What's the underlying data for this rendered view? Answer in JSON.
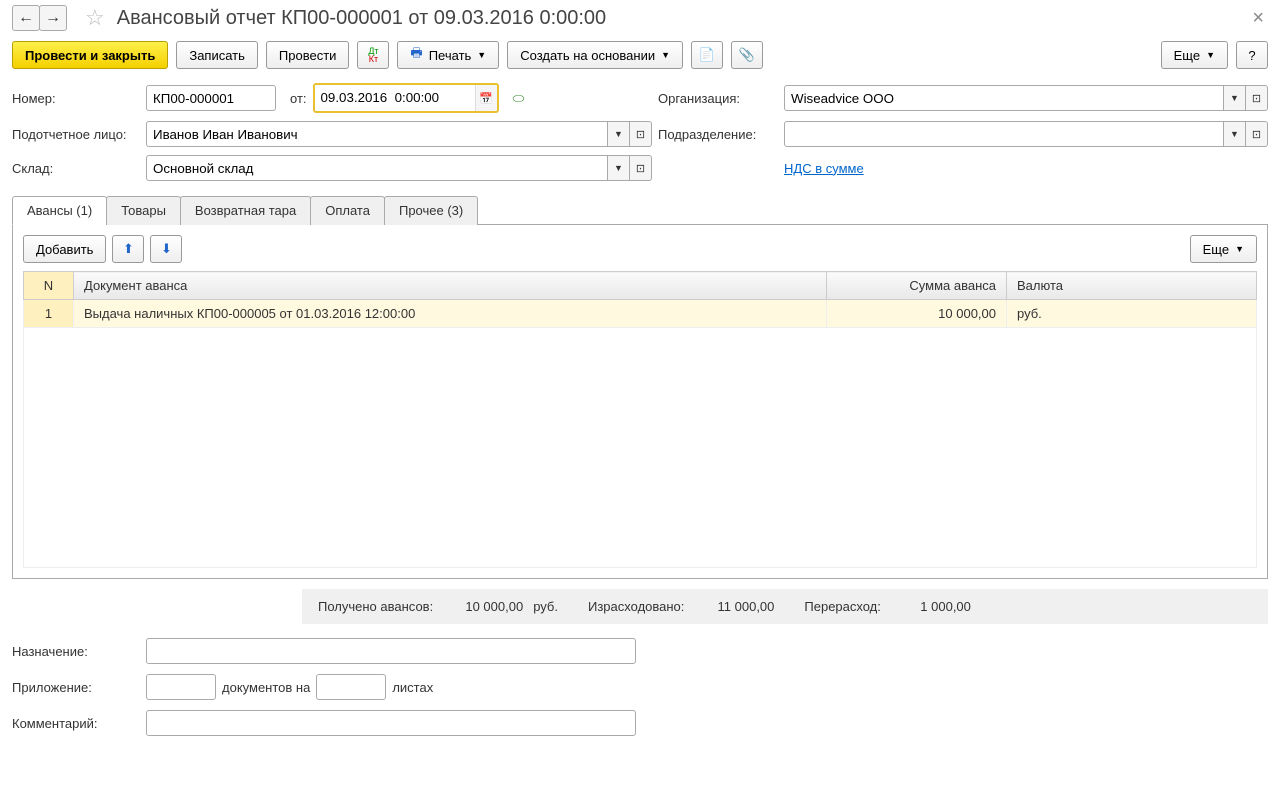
{
  "header": {
    "title": "Авансовый отчет КП00-000001 от 09.03.2016 0:00:00"
  },
  "toolbar": {
    "post_close": "Провести и закрыть",
    "save": "Записать",
    "post": "Провести",
    "print": "Печать",
    "create_based": "Создать на основании",
    "more": "Еще",
    "help": "?"
  },
  "form": {
    "number_lbl": "Номер:",
    "number": "КП00-000001",
    "from_lbl": "от:",
    "date": "09.03.2016  0:00:00",
    "org_lbl": "Организация:",
    "org": "Wiseadvice ООО",
    "person_lbl": "Подотчетное лицо:",
    "person": "Иванов Иван Иванович",
    "dept_lbl": "Подразделение:",
    "dept": "",
    "warehouse_lbl": "Склад:",
    "warehouse": "Основной склад",
    "vat_link": "НДС в сумме"
  },
  "tabs": {
    "advances": "Авансы (1)",
    "goods": "Товары",
    "packaging": "Возвратная тара",
    "payment": "Оплата",
    "other": "Прочее (3)"
  },
  "tab_toolbar": {
    "add": "Добавить",
    "more": "Еще"
  },
  "table": {
    "col_n": "N",
    "col_doc": "Документ аванса",
    "col_sum": "Сумма аванса",
    "col_cur": "Валюта",
    "rows": [
      {
        "n": "1",
        "doc": "Выдача наличных КП00-000005 от 01.03.2016 12:00:00",
        "sum": "10 000,00",
        "cur": "руб."
      }
    ]
  },
  "summary": {
    "received_lbl": "Получено авансов:",
    "received": "10 000,00",
    "received_cur": "руб.",
    "spent_lbl": "Израсходовано:",
    "spent": "11 000,00",
    "over_lbl": "Перерасход:",
    "over": "1 000,00"
  },
  "bottom": {
    "purpose_lbl": "Назначение:",
    "attach_lbl": "Приложение:",
    "docs_txt": "документов на",
    "sheets_txt": "листах",
    "comment_lbl": "Комментарий:"
  }
}
